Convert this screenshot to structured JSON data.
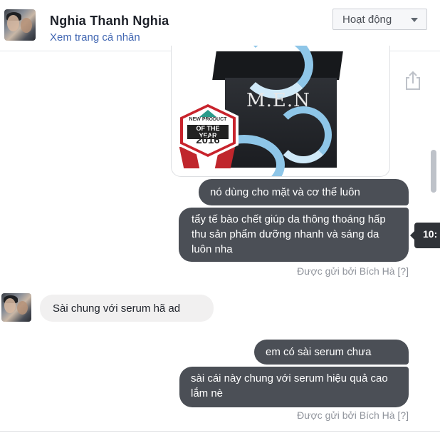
{
  "header": {
    "name": "Nghia Thanh Nghia",
    "profile_link": "Xem trang cá nhân",
    "status_button": "Hoạt động"
  },
  "attachment": {
    "product_logo": "M.E.N",
    "badge_line1": "NEW PRODUCT",
    "badge_line2": "OF THE YEAR",
    "badge_year": "2016"
  },
  "messages": [
    {
      "side": "out",
      "text": "nó dùng cho mặt và cơ thể luôn"
    },
    {
      "side": "out",
      "text": "tẩy tế bào chết giúp da thông thoáng  hấp thu sản phẩm dưỡng nhanh và sáng da luôn nha"
    },
    {
      "side": "in",
      "text": "Sài chung với serum hã ad"
    },
    {
      "side": "out",
      "text": "em có sài serum chưa"
    },
    {
      "side": "out",
      "text": "sài cái này chung với serum hiệu quả cao lắm nè"
    }
  ],
  "sent_by_1": "Được gửi bởi Bích Hà [?]",
  "sent_by_2": "Được gửi bởi Bích Hà [?]",
  "timestamp_tooltip": "10:",
  "colors": {
    "outgoing_bubble": "#4b4f56",
    "incoming_bubble": "#f1f0f0",
    "link": "#4267b2"
  }
}
